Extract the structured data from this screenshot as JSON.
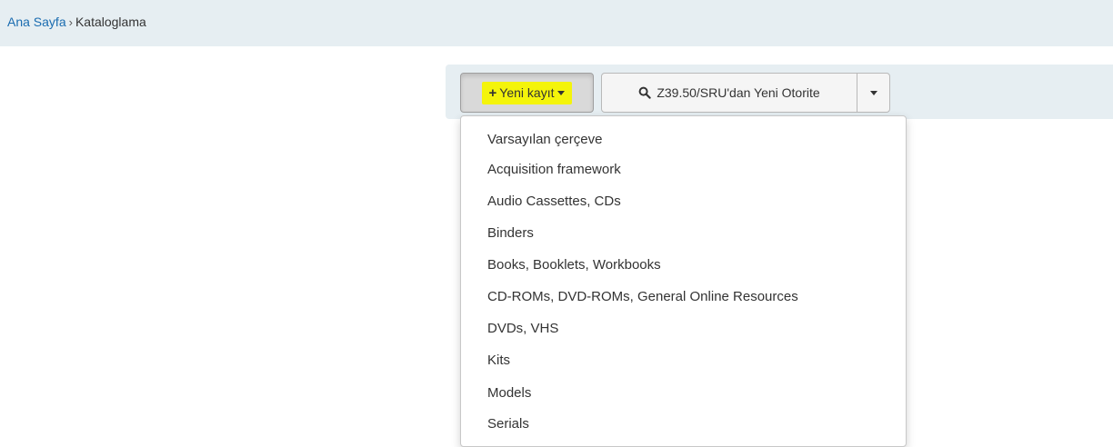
{
  "breadcrumb": {
    "home": "Ana Sayfa",
    "separator": "›",
    "current": "Kataloglama"
  },
  "toolbar": {
    "new_record_label": "Yeni kayıt",
    "z3950_label": "Z39.50/SRU'dan Yeni Otorite"
  },
  "dropdown": {
    "items": [
      "Varsayılan çerçeve",
      "Acquisition framework",
      "Audio Cassettes, CDs",
      "Binders",
      "Books, Booklets, Workbooks",
      "CD-ROMs, DVD-ROMs, General Online Resources",
      "DVDs, VHS",
      "Kits",
      "Models",
      "Serials"
    ]
  },
  "colors": {
    "highlight": "#f4f40a",
    "link": "#1a6cb0",
    "bar_background": "#e6eef2"
  },
  "icons": {
    "new_record": "plus-icon",
    "z3950": "search-icon",
    "split": "caret-down-icon"
  }
}
